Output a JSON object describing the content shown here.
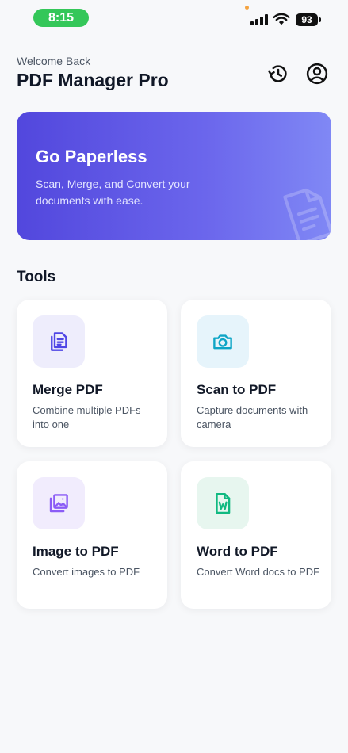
{
  "status_bar": {
    "time": "8:15",
    "battery": "93",
    "pill_color": "#34c759"
  },
  "header": {
    "welcome": "Welcome Back",
    "title": "PDF Manager Pro",
    "icons": [
      "history-icon",
      "profile-icon"
    ]
  },
  "hero": {
    "title": "Go Paperless",
    "subtitle": "Scan, Merge, and Convert your documents with ease.",
    "gradient": [
      "#5247dd",
      "#8088f5"
    ]
  },
  "tools": {
    "title": "Tools",
    "items": [
      {
        "title": "Merge PDF",
        "desc": "Combine multiple PDFs into one",
        "icon": "document-stack-icon",
        "icon_color": "#4f46e5",
        "bg": "#eeedfc"
      },
      {
        "title": "Scan to PDF",
        "desc": "Capture documents with camera",
        "icon": "camera-icon",
        "icon_color": "#0ea5c6",
        "bg": "#e6f4fb"
      },
      {
        "title": "Image to PDF",
        "desc": "Convert images to PDF",
        "icon": "image-stack-icon",
        "icon_color": "#8b5cf6",
        "bg": "#f1ecfd"
      },
      {
        "title": "Word to PDF",
        "desc": "Convert Word docs to PDF",
        "icon": "word-document-icon",
        "icon_color": "#10b981",
        "bg": "#e7f6ef"
      }
    ]
  }
}
